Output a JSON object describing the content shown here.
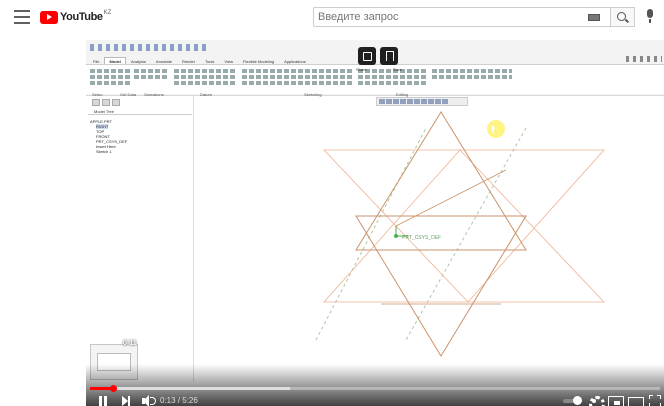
{
  "header": {
    "logo_text": "YouTube",
    "region": "KZ",
    "search_placeholder": "Введите запрос"
  },
  "icons": {
    "menu": "hamburger-menu-icon",
    "keyboard": "keyboard-icon",
    "search": "search-icon",
    "mic": "microphone-icon"
  },
  "video_overlay": {
    "share_label": "Share",
    "save_label": "Save"
  },
  "cad": {
    "tabs": [
      "File",
      "Model",
      "Analysis",
      "Annotate",
      "Render",
      "Tools",
      "View",
      "Flexible Modeling",
      "Applications"
    ],
    "active_tab": "Model",
    "tree_header": "Model Tree",
    "tree_items": [
      {
        "label": "APPLE.PRT",
        "selected": false
      },
      {
        "label": "RIGHT",
        "selected": true
      },
      {
        "label": "TOP",
        "selected": false
      },
      {
        "label": "FRONT",
        "selected": false
      },
      {
        "label": "PRT_CSYS_DEF",
        "selected": false
      },
      {
        "label": "Insert Here",
        "selected": false
      },
      {
        "label": "Sketch 1",
        "selected": false
      }
    ],
    "csys_label": "PRT_CSYS_DEF",
    "ribbon_groups": [
      "Setup",
      "Get Data",
      "Operations",
      "Datum",
      "Sketching",
      "Editing"
    ]
  },
  "player": {
    "current_time": "0:13",
    "duration": "5:26",
    "time_display": "0:13 / 5:26",
    "thumbnail_time": "0:11",
    "progress_played": 0.04,
    "progress_buffered": 0.35,
    "autoplay_on": true
  },
  "colors": {
    "youtube_red": "#ff0000",
    "progress_red": "#ff0000",
    "sketch_line": "#c9936c",
    "datum_plane": "#f0b090",
    "highlight": "#fff05a"
  }
}
